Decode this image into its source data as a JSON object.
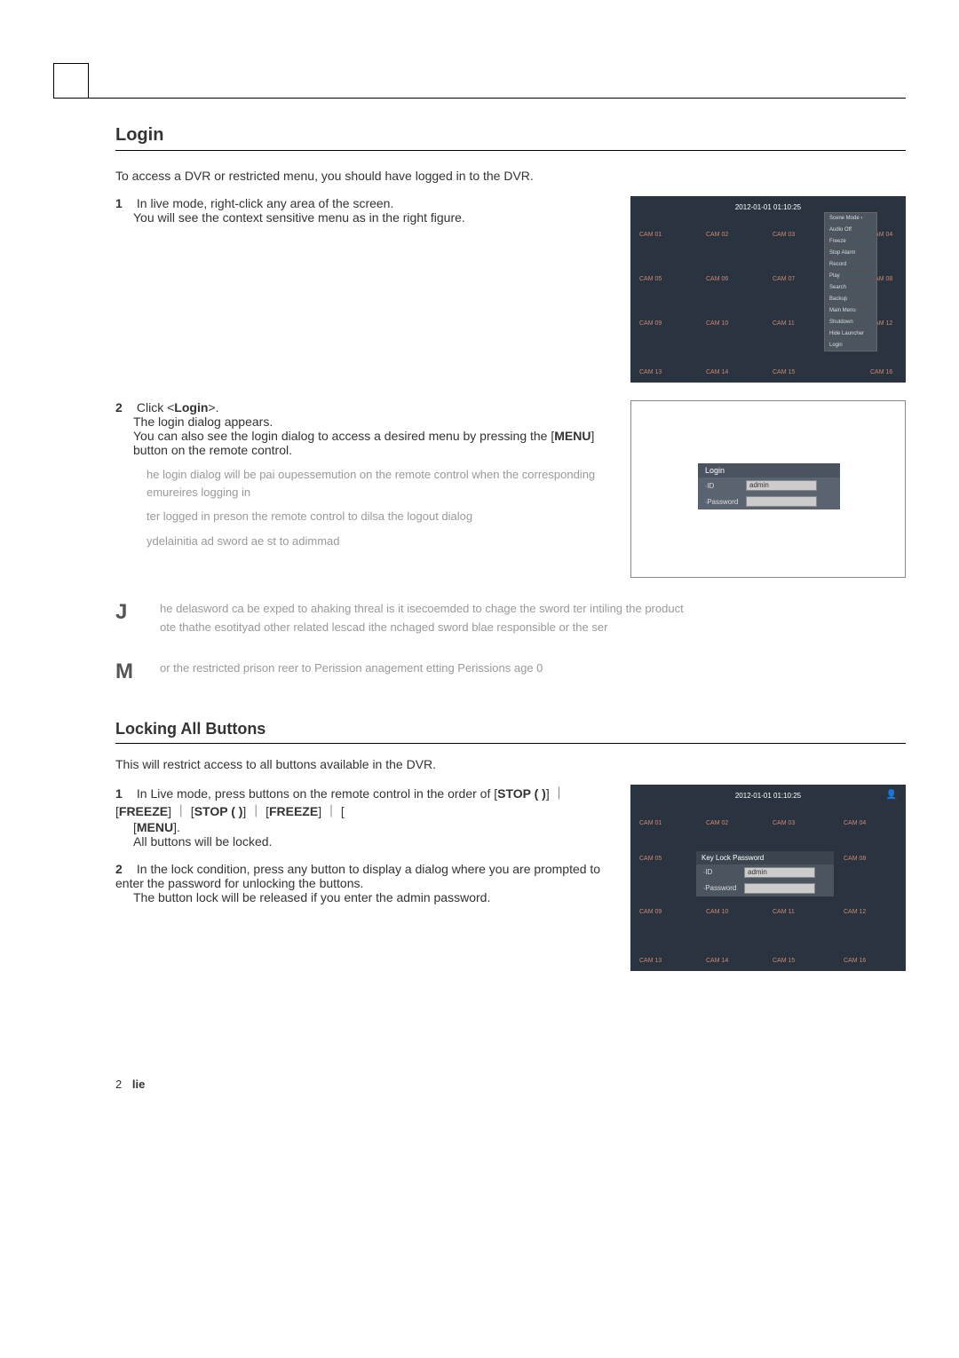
{
  "section": {
    "loginTitle": "Login",
    "loginIntro": "To access a DVR or restricted menu, you should have logged in to the DVR.",
    "step1num": "1",
    "step1a": "In live mode, right-click any area of the screen.",
    "step1b": "You will see the context sensitive menu as in the right figure.",
    "step2num": "2",
    "step2a": "Click <",
    "step2aBold": "Login",
    "step2aEnd": ">.",
    "step2b": "The login dialog appears.",
    "step2c": "You can also see the login dialog to access a desired menu by pressing the [",
    "step2cBold": "MENU",
    "step2cEnd": "] button on the remote control.",
    "sub1": "he login dialog will be pai oupessemution on the remote control when the corresponding emureires logging in",
    "sub2": "ter logged in preson the remote control to dilsa the logout dialog",
    "sub3": "ydelainitia ad sword ae st to adimmad",
    "noteJIcon": "J",
    "noteJ1": "he delasword ca be exped to ahaking threal is it isecoemded to chage the sword ter intiling the product",
    "noteJ2": "ote thathe esotityad other related lescad ithe nchaged sword blae responsible or the ser",
    "noteMIcon": "M",
    "noteM": "or the restricted prison reer to Perission anagement  etting Perissions age 0",
    "noteMBold1": "Perission anagement",
    "noteMBold2": "Perissions"
  },
  "locking": {
    "title": "Locking All Buttons",
    "intro": "This will restrict access to all buttons available in the DVR.",
    "step1num": "1",
    "step1a": "In Live mode, press buttons on the remote control in the order of [",
    "step1b1": "STOP (  )",
    "step1s1": "] ｜ [",
    "step1b2": "FREEZE",
    "step1s2": "] ｜ [",
    "step1b3": "STOP (  )",
    "step1s3": "] ｜ [",
    "step1b4": "FREEZE",
    "step1s4": "] ｜ [",
    "step1b5": "MENU",
    "step1end": "].",
    "step1c": "All buttons will be locked.",
    "step2num": "2",
    "step2a": "In the lock condition, press any button to display a dialog where you are prompted to enter the password for unlocking the buttons.",
    "step2b": "The button lock will be released if you enter the admin password."
  },
  "dvr": {
    "timestamp": "2012-01-01 01:10:25",
    "cams": [
      "CAM 01",
      "CAM 02",
      "CAM 03",
      "CAM 04",
      "CAM 05",
      "CAM 06",
      "CAM 07",
      "CAM 08",
      "CAM 09",
      "CAM 10",
      "CAM 11",
      "CAM 12",
      "CAM 13",
      "CAM 14",
      "CAM 15",
      "CAM 16"
    ],
    "menu": [
      "Scene Mode   ›",
      "Audio Off",
      "Freeze",
      "Stop Alarm",
      "Record",
      "Play",
      "Search",
      "Backup",
      "Main Menu",
      "Shutdown",
      "Hide Launcher",
      "Login"
    ],
    "loginTitle": "Login",
    "idLabel": "∙ID",
    "pwLabel": "∙Password",
    "idValue": "admin",
    "keylockTitle": "Key Lock Password"
  },
  "footer": {
    "pageNum": "2",
    "section": "lie"
  }
}
